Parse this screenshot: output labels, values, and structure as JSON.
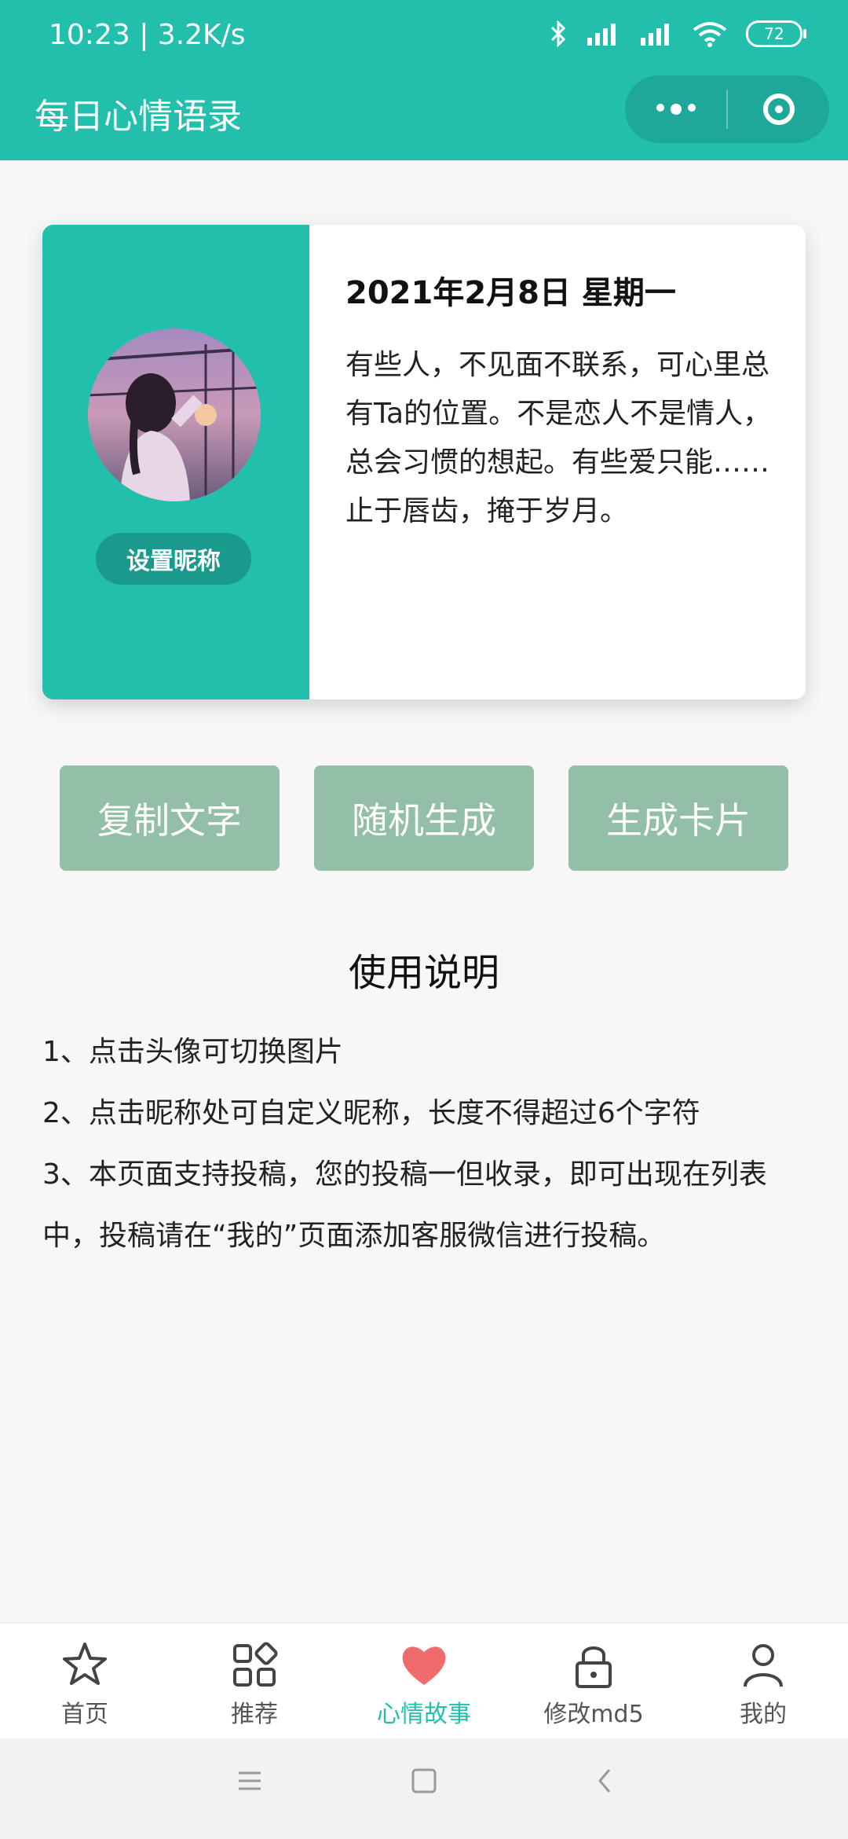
{
  "status_bar": {
    "time": "10:23",
    "speed": "3.2K/s",
    "battery": "72"
  },
  "header": {
    "title": "每日心情语录",
    "menu_icon": "more-dots-icon",
    "close_icon": "target-icon"
  },
  "card": {
    "date": "2021年2月8日 星期一",
    "quote": "有些人，不见面不联系，可心里总有Ta的位置。不是恋人不是情人，总会习惯的想起。有些爱只能……止于唇齿，掩于岁月。",
    "nickname_button": "设置昵称"
  },
  "actions": {
    "copy": "复制文字",
    "random": "随机生成",
    "card": "生成卡片"
  },
  "help": {
    "title": "使用说明",
    "items": [
      "1、点击头像可切换图片",
      "2、点击昵称处可自定义昵称，长度不得超过6个字符",
      "3、本页面支持投稿，您的投稿一但收录，即可出现在列表中，投稿请在“我的”页面添加客服微信进行投稿。"
    ]
  },
  "tabs": [
    {
      "label": "首页",
      "icon": "star-icon"
    },
    {
      "label": "推荐",
      "icon": "grid-icon"
    },
    {
      "label": "心情故事",
      "icon": "heart-icon"
    },
    {
      "label": "修改md5",
      "icon": "lock-icon"
    },
    {
      "label": "我的",
      "icon": "user-icon"
    }
  ],
  "colors": {
    "accent": "#22bfad",
    "button": "#93bea8",
    "heart": "#f06b6b"
  }
}
